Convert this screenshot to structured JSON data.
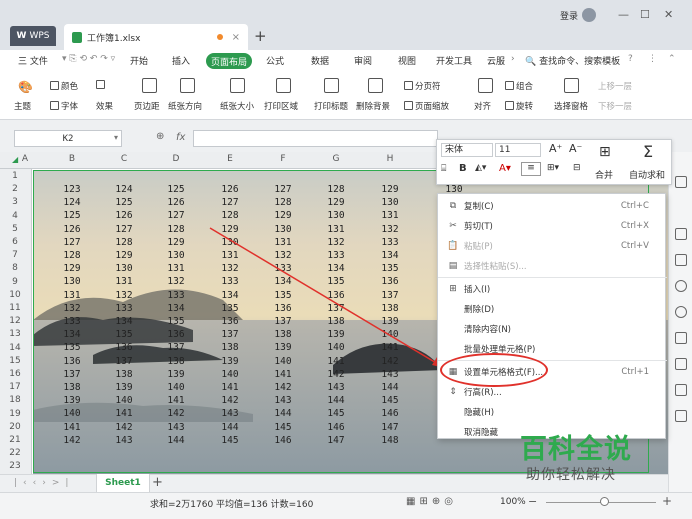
{
  "titlebar": {
    "app_tab": "WPS",
    "file_tab": "工作簿1.xlsx",
    "login": "登录",
    "new_tab": "+"
  },
  "menu": {
    "file": "三 文件",
    "items": [
      "开始",
      "插入",
      "页面布局",
      "公式",
      "数据",
      "审阅",
      "视图",
      "开发工具",
      "云服"
    ],
    "active": "页面布局",
    "search": "查找命令、搜索模板"
  },
  "ribbon": {
    "theme": "主题",
    "color": "颜色",
    "font": "字体",
    "effect": "效果",
    "margin": "页边距",
    "orientation": "纸张方向",
    "size": "纸张大小",
    "print_area": "打印区域",
    "print_title": "打印标题",
    "remove_bg": "删除背景",
    "page_break": "分页符",
    "page_scale": "页面缩放",
    "align": "对齐",
    "group": "组合",
    "rotate": "旋转",
    "select_pane": "选择窗格",
    "up_layer": "上移一层",
    "down_layer": "下移一层"
  },
  "formula_bar": {
    "cell_ref": "K2",
    "fx": "fx"
  },
  "columns": [
    "A",
    "B",
    "C",
    "D",
    "E",
    "F",
    "G",
    "H"
  ],
  "rows": [
    "1",
    "2",
    "3",
    "4",
    "5",
    "6",
    "7",
    "8",
    "9",
    "10",
    "11",
    "12",
    "13",
    "14",
    "15",
    "16",
    "17",
    "18",
    "19",
    "20",
    "21",
    "22",
    "23"
  ],
  "cells": [
    [
      "123",
      "124",
      "125",
      "126",
      "127",
      "128",
      "129",
      "130"
    ],
    [
      "124",
      "125",
      "126",
      "127",
      "128",
      "129",
      "130",
      "131"
    ],
    [
      "125",
      "126",
      "127",
      "128",
      "129",
      "130",
      "131",
      "132"
    ],
    [
      "126",
      "127",
      "128",
      "129",
      "130",
      "131",
      "132",
      "133"
    ],
    [
      "127",
      "128",
      "129",
      "130",
      "131",
      "132",
      "133",
      "134"
    ],
    [
      "128",
      "129",
      "130",
      "131",
      "132",
      "133",
      "134",
      "135"
    ],
    [
      "129",
      "130",
      "131",
      "132",
      "133",
      "134",
      "135",
      "136"
    ],
    [
      "130",
      "131",
      "132",
      "133",
      "134",
      "135",
      "136",
      "137"
    ],
    [
      "131",
      "132",
      "133",
      "134",
      "135",
      "136",
      "137",
      "138"
    ],
    [
      "132",
      "133",
      "134",
      "135",
      "136",
      "137",
      "138",
      "139"
    ],
    [
      "133",
      "134",
      "135",
      "136",
      "137",
      "138",
      "139",
      "140"
    ],
    [
      "134",
      "135",
      "136",
      "137",
      "138",
      "139",
      "140",
      "141"
    ],
    [
      "135",
      "136",
      "137",
      "138",
      "139",
      "140",
      "141",
      "142"
    ],
    [
      "136",
      "137",
      "138",
      "139",
      "140",
      "141",
      "142",
      "143"
    ],
    [
      "137",
      "138",
      "139",
      "140",
      "141",
      "142",
      "143",
      "144"
    ],
    [
      "138",
      "139",
      "140",
      "141",
      "142",
      "143",
      "144",
      "145"
    ],
    [
      "139",
      "140",
      "141",
      "142",
      "143",
      "144",
      "145",
      "146"
    ],
    [
      "140",
      "141",
      "142",
      "143",
      "144",
      "145",
      "146",
      "147"
    ],
    [
      "141",
      "142",
      "143",
      "144",
      "145",
      "146",
      "147",
      "148"
    ],
    [
      "142",
      "143",
      "144",
      "145",
      "146",
      "147",
      "148",
      "149"
    ]
  ],
  "mini_toolbar": {
    "font": "宋体",
    "size": "11",
    "grow": "A⁺",
    "shrink": "A⁻",
    "merge": "合并",
    "autosum": "自动求和"
  },
  "context_menu": [
    {
      "icon": "⧉",
      "label": "复制(C)",
      "shortcut": "Ctrl+C",
      "disabled": false
    },
    {
      "icon": "✂",
      "label": "剪切(T)",
      "shortcut": "Ctrl+X",
      "disabled": false
    },
    {
      "icon": "📋",
      "label": "粘贴(P)",
      "shortcut": "Ctrl+V",
      "disabled": true
    },
    {
      "icon": "▤",
      "label": "选择性粘贴(S)...",
      "shortcut": "",
      "disabled": true
    },
    {
      "icon": "⊞",
      "label": "插入(I)",
      "shortcut": "",
      "disabled": false
    },
    {
      "icon": "",
      "label": "删除(D)",
      "shortcut": "",
      "disabled": false
    },
    {
      "icon": "",
      "label": "清除内容(N)",
      "shortcut": "",
      "disabled": false
    },
    {
      "icon": "",
      "label": "批量处理单元格(P)",
      "shortcut": "",
      "disabled": false
    },
    {
      "icon": "▦",
      "label": "设置单元格格式(F)...",
      "shortcut": "Ctrl+1",
      "disabled": false
    },
    {
      "icon": "⇕",
      "label": "行高(R)...",
      "shortcut": "",
      "disabled": false
    },
    {
      "icon": "",
      "label": "隐藏(H)",
      "shortcut": "",
      "disabled": false
    },
    {
      "icon": "",
      "label": "取消隐藏",
      "shortcut": "",
      "disabled": false
    }
  ],
  "sheet_tab": "Sheet1",
  "status": {
    "summary": "求和=2万1760  平均值=136  计数=160",
    "zoom": "100%"
  },
  "watermark": {
    "title": "百科全说",
    "subtitle": "助你轻松解决"
  }
}
